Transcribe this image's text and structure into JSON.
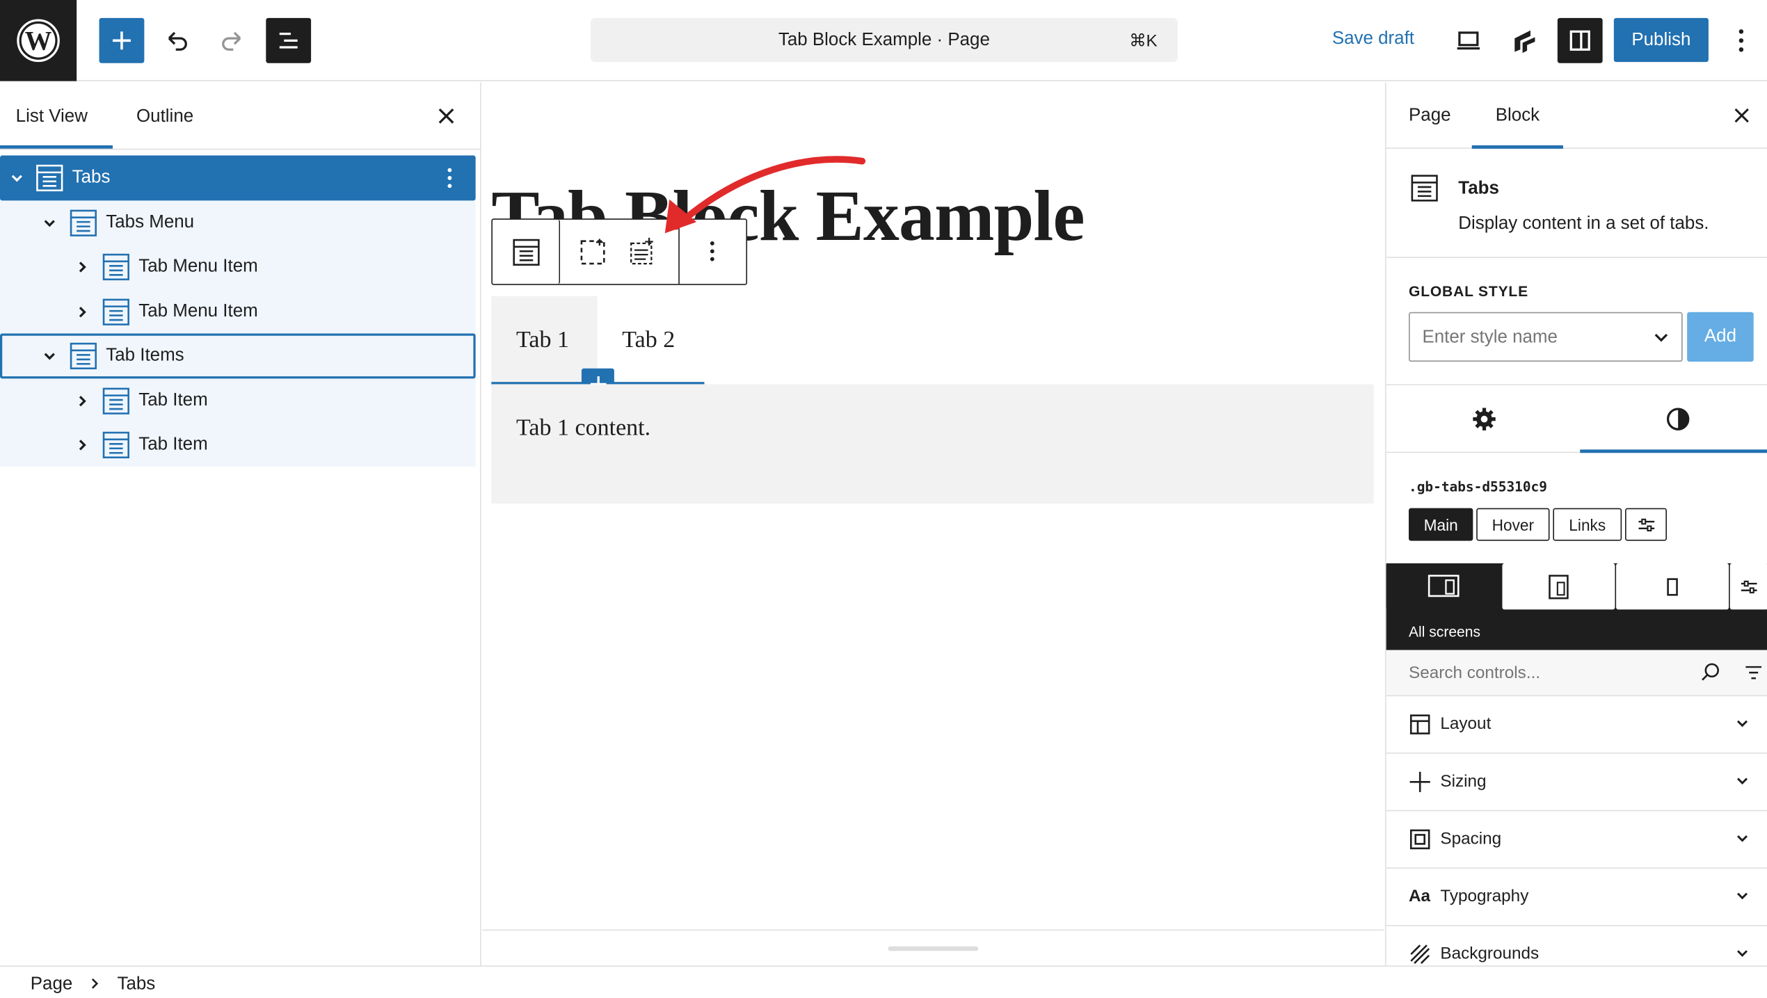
{
  "topbar": {
    "logo_icon": "wordpress-logo",
    "document_title": "Tab Block Example · Page",
    "shortcut": "⌘K",
    "save_draft": "Save draft",
    "publish": "Publish",
    "accent": "#2271b1"
  },
  "left_panel": {
    "tabs": [
      "List View",
      "Outline"
    ],
    "active_tab": "List View",
    "tree": [
      {
        "label": "Tabs",
        "level": 0,
        "selected": true
      },
      {
        "label": "Tabs Menu",
        "level": 1
      },
      {
        "label": "Tab Menu Item",
        "level": 2
      },
      {
        "label": "Tab Menu Item",
        "level": 2
      },
      {
        "label": "Tab Items",
        "level": 1,
        "focused": true
      },
      {
        "label": "Tab Item",
        "level": 2
      },
      {
        "label": "Tab Item",
        "level": 2
      }
    ]
  },
  "canvas": {
    "title": "Tab Block Example",
    "tabs": [
      "Tab 1",
      "Tab 2"
    ],
    "content": "Tab 1 content."
  },
  "right_panel": {
    "tabs": [
      "Page",
      "Block"
    ],
    "active_tab": "Block",
    "block_name": "Tabs",
    "block_description": "Display content in a set of tabs.",
    "global_style_label": "GLOBAL STYLE",
    "style_placeholder": "Enter style name",
    "add_button": "Add",
    "selector": ".gb-tabs-d55310c9",
    "state_buttons": [
      "Main",
      "Hover",
      "Links"
    ],
    "device_label": "All screens",
    "search_placeholder": "Search controls...",
    "sections": [
      "Layout",
      "Sizing",
      "Spacing",
      "Typography",
      "Backgrounds"
    ]
  },
  "footer": {
    "breadcrumb": [
      "Page",
      "Tabs"
    ]
  }
}
